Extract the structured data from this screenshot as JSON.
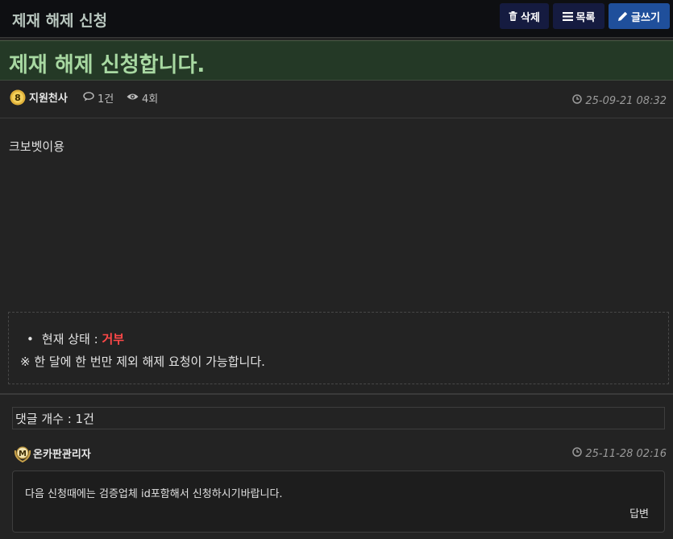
{
  "header": {
    "title": "제재 해제 신청",
    "buttons": {
      "delete_label": "삭제",
      "list_label": "목록",
      "write_label": "글쓰기"
    }
  },
  "post": {
    "title": "제재 해제 신청합니다.",
    "author": "지원천사",
    "author_level": "8",
    "comment_count": "1건",
    "views": "4회",
    "date": "25-09-21 08:32",
    "body": "크보벳이용",
    "status_label": "현재 상태 :",
    "status_value": "거부",
    "notice": "※ 한 달에 한 번만 제외 해제 요청이 가능합니다."
  },
  "comments": {
    "count_label": "댓글 개수 : 1건",
    "items": [
      {
        "author": "온카판관리자",
        "badge": "M",
        "date": "25-11-28 02:16",
        "text": "다음 신청때에는 검증업체 id포함해서 신청하시기바랍니다.",
        "reply_label": "답변"
      }
    ]
  },
  "icons": {
    "delete": "trash-icon",
    "list": "list-icon",
    "write": "pencil-icon",
    "comments": "comment-bubble-icon",
    "views": "eye-icon",
    "date": "clock-icon"
  },
  "colors": {
    "header_bg": "#0e0f12",
    "title_banner_bg": "#243926",
    "title_text": "#a8d9a2",
    "status_rejected": "#ff4848",
    "write_button": "#1f4f9b",
    "nav_button": "#151b40"
  }
}
